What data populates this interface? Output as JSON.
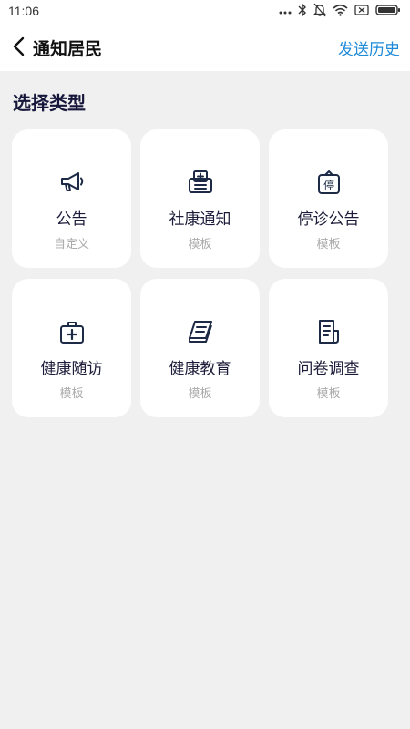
{
  "status_bar": {
    "time": "11:06",
    "icons": [
      "more-dots-icon",
      "bluetooth-icon",
      "mute-bell-icon",
      "wifi-icon",
      "sim-icon",
      "battery-icon"
    ]
  },
  "nav": {
    "title": "通知居民",
    "history": "发送历史",
    "accent_color": "#1f8ad8"
  },
  "section_title": "选择类型",
  "cards": [
    {
      "title": "公告",
      "sub": "自定义",
      "icon": "megaphone-icon"
    },
    {
      "title": "社康通知",
      "sub": "模板",
      "icon": "clinic-icon"
    },
    {
      "title": "停诊公告",
      "sub": "模板",
      "icon": "suspend-sign-icon"
    },
    {
      "title": "健康随访",
      "sub": "模板",
      "icon": "medical-kit-icon"
    },
    {
      "title": "健康教育",
      "sub": "模板",
      "icon": "book-icon"
    },
    {
      "title": "问卷调查",
      "sub": "模板",
      "icon": "questionnaire-icon"
    }
  ]
}
